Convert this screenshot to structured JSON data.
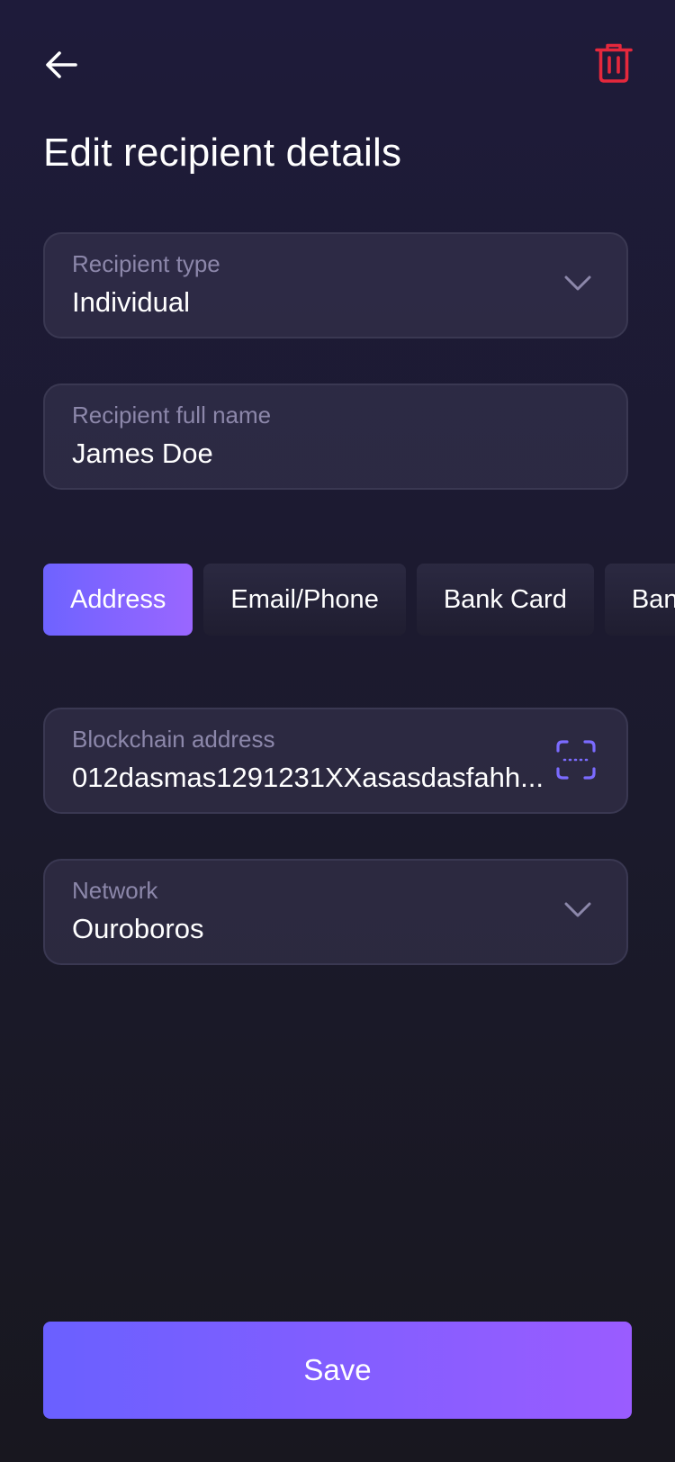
{
  "header": {
    "back_icon": "arrow-left-icon",
    "delete_icon": "trash-icon",
    "delete_color": "#e5283c"
  },
  "title": "Edit recipient details",
  "fields": {
    "recipient_type": {
      "label": "Recipient type",
      "value": "Individual",
      "icon": "chevron-down-icon"
    },
    "full_name": {
      "label": "Recipient full name",
      "value": "James Doe"
    },
    "address": {
      "label": "Blockchain address",
      "value": "012dasmas1291231XXasasdasfahh...",
      "icon": "scan-icon",
      "icon_color": "#7b6bff"
    },
    "network": {
      "label": "Network",
      "value": "Ouroboros",
      "icon": "chevron-down-icon"
    }
  },
  "tabs": [
    {
      "label": "Address",
      "active": true
    },
    {
      "label": "Email/Phone",
      "active": false
    },
    {
      "label": "Bank Card",
      "active": false
    },
    {
      "label": "Bank",
      "active": false
    }
  ],
  "save_label": "Save",
  "colors": {
    "accent_start": "#6a60ff",
    "accent_end": "#9a5cff",
    "background": "#1e1b3a",
    "label": "#8c87aa"
  }
}
